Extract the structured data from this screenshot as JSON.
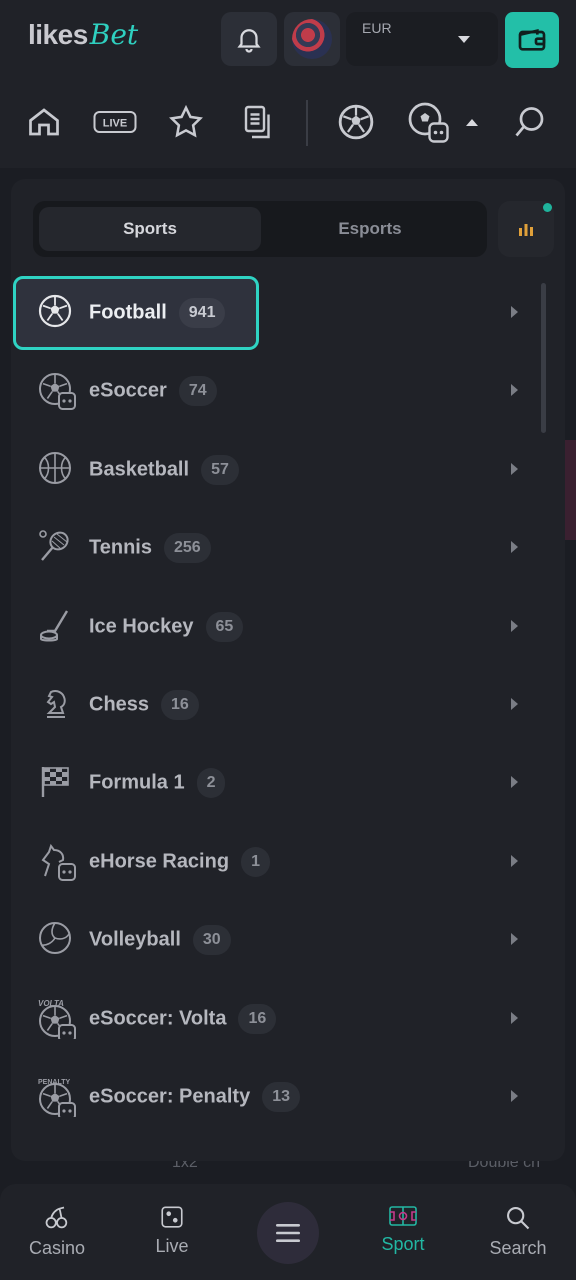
{
  "header": {
    "logo_part1": "likes",
    "logo_part2": "Bet",
    "currency": "EUR",
    "icons": [
      "bell-icon",
      "avatar",
      "wallet-icon"
    ]
  },
  "nav_icons": [
    "home-icon",
    "live-icon",
    "star-icon",
    "coupon-icon",
    "football-icon",
    "esoccer-icon",
    "search-icon"
  ],
  "nav_live_label": "LIVE",
  "panel": {
    "tabs": {
      "sports": "Sports",
      "esports": "Esports"
    },
    "items": [
      {
        "label": "Football",
        "count": "941",
        "icon": "football-icon",
        "selected": true
      },
      {
        "label": "eSoccer",
        "count": "74",
        "icon": "esoccer-icon"
      },
      {
        "label": "Basketball",
        "count": "57",
        "icon": "basketball-icon"
      },
      {
        "label": "Tennis",
        "count": "256",
        "icon": "tennis-icon"
      },
      {
        "label": "Ice Hockey",
        "count": "65",
        "icon": "ice-hockey-icon"
      },
      {
        "label": "Chess",
        "count": "16",
        "icon": "chess-icon"
      },
      {
        "label": "Formula 1",
        "count": "2",
        "icon": "formula1-icon"
      },
      {
        "label": "eHorse Racing",
        "count": "1",
        "icon": "ehorse-racing-icon"
      },
      {
        "label": "Volleyball",
        "count": "30",
        "icon": "volleyball-icon"
      },
      {
        "label": "eSoccer: Volta",
        "count": "16",
        "icon": "esoccer-volta-icon"
      },
      {
        "label": "eSoccer: Penalty",
        "count": "13",
        "icon": "esoccer-penalty-icon"
      }
    ]
  },
  "peek": {
    "left": "1x2",
    "right": "Double ch"
  },
  "bottom_nav": {
    "casino": "Casino",
    "live": "Live",
    "sport": "Sport",
    "search": "Search"
  },
  "colors": {
    "accent": "#2fd3c3",
    "wallet": "#23bfa8",
    "active_nav": "#22b7a3"
  }
}
